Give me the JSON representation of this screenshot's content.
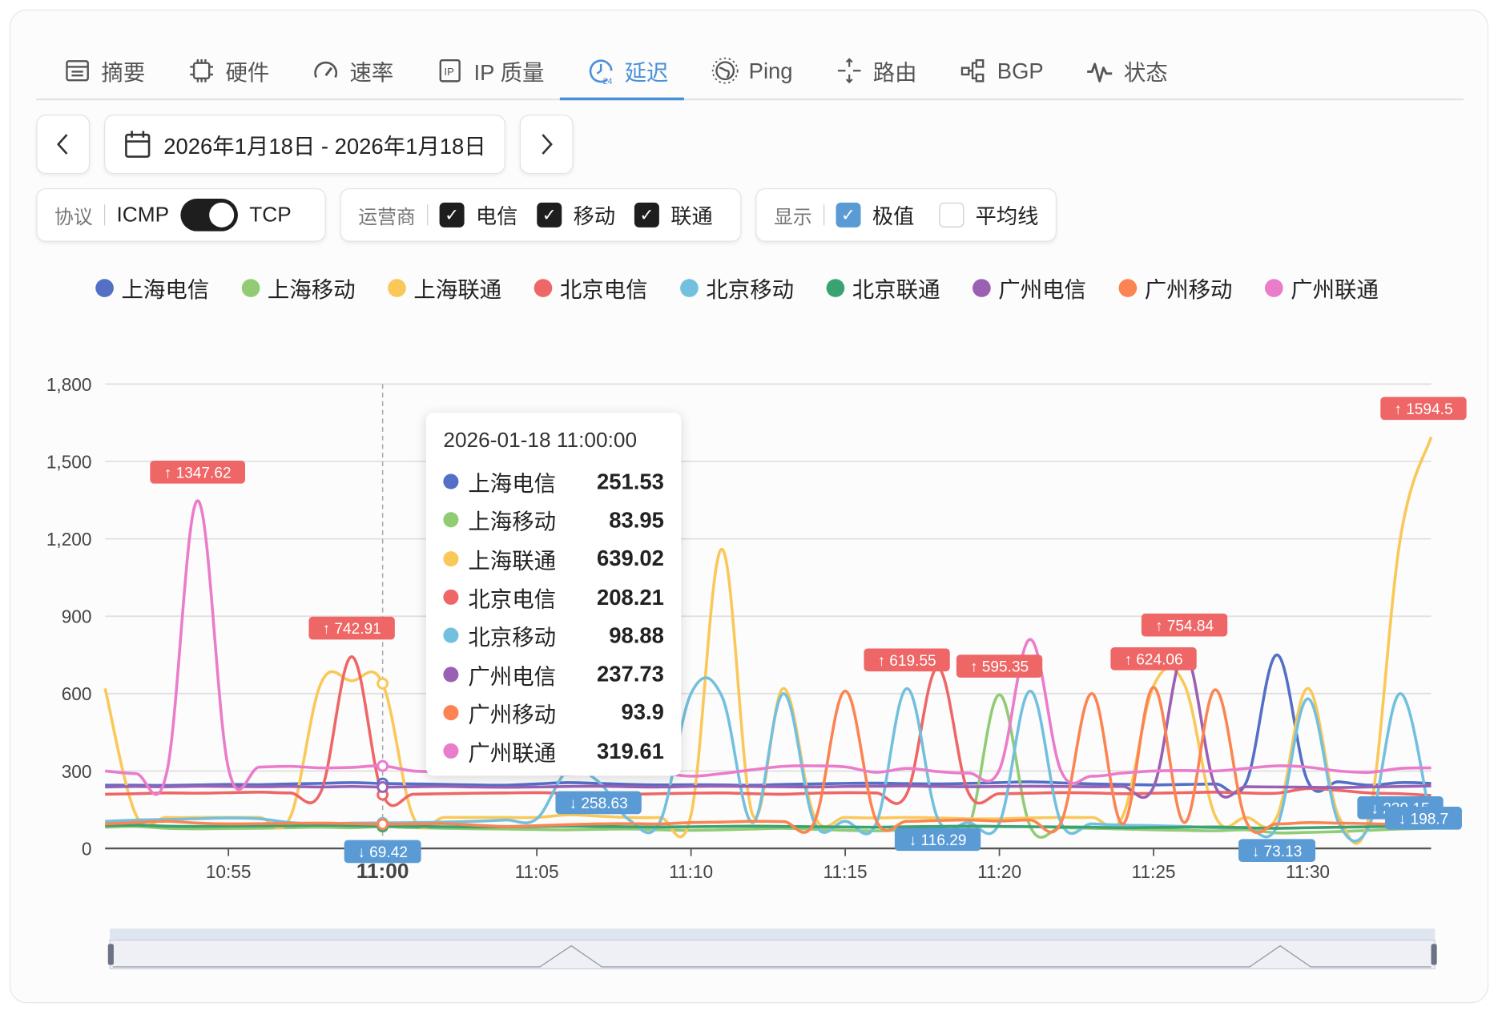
{
  "tabs": [
    {
      "label": "摘要",
      "icon": "summary-icon"
    },
    {
      "label": "硬件",
      "icon": "chip-icon"
    },
    {
      "label": "速率",
      "icon": "speedometer-icon"
    },
    {
      "label": "IP 质量",
      "icon": "ip-icon"
    },
    {
      "label": "延迟",
      "icon": "clock-24-icon",
      "active": true
    },
    {
      "label": "Ping",
      "icon": "globe-icon"
    },
    {
      "label": "路由",
      "icon": "route-icon"
    },
    {
      "label": "BGP",
      "icon": "bgp-icon"
    },
    {
      "label": "状态",
      "icon": "pulse-icon"
    }
  ],
  "date_range": "2026年1月18日 - 2026年1月18日",
  "protocol": {
    "label": "协议",
    "left": "ICMP",
    "right": "TCP",
    "value": "TCP"
  },
  "carrier": {
    "label": "运营商",
    "options": [
      {
        "label": "电信",
        "checked": true
      },
      {
        "label": "移动",
        "checked": true
      },
      {
        "label": "联通",
        "checked": true
      }
    ]
  },
  "display": {
    "label": "显示",
    "options": [
      {
        "label": "极值",
        "checked": true
      },
      {
        "label": "平均线",
        "checked": false
      }
    ]
  },
  "tooltip": {
    "title": "2026-01-18 11:00:00",
    "rows": [
      {
        "name": "上海电信",
        "value": "251.53"
      },
      {
        "name": "上海移动",
        "value": "83.95"
      },
      {
        "name": "上海联通",
        "value": "639.02"
      },
      {
        "name": "北京电信",
        "value": "208.21"
      },
      {
        "name": "北京移动",
        "value": "98.88"
      },
      {
        "name": "广州电信",
        "value": "237.73"
      },
      {
        "name": "广州移动",
        "value": "93.9"
      },
      {
        "name": "广州联通",
        "value": "319.61"
      }
    ]
  },
  "chart_data": {
    "type": "line",
    "x_start": "10:51",
    "x_step_minutes": 1,
    "x_ticks": [
      "10:55",
      "11:00",
      "11:05",
      "11:10",
      "11:15",
      "11:20",
      "11:25",
      "11:30"
    ],
    "y_ticks": [
      "0",
      "300",
      "600",
      "900",
      "1,200",
      "1,500",
      "1,800"
    ],
    "ylim": [
      0,
      1800
    ],
    "grid": true,
    "legend_position": "top",
    "series": [
      {
        "name": "上海电信",
        "color": "#5470c6",
        "values": [
          245,
          245,
          244,
          246,
          248,
          247,
          250,
          252,
          255,
          251.53,
          250,
          248,
          246,
          245,
          250,
          255,
          252,
          248,
          246,
          247,
          246,
          245,
          248,
          250,
          252,
          253,
          251,
          250,
          252,
          255,
          258,
          254,
          250,
          248,
          246,
          248,
          250,
          255,
          750,
          260,
          258,
          245,
          255,
          252
        ]
      },
      {
        "name": "上海移动",
        "color": "#91cc75",
        "values": [
          82,
          85,
          78,
          76,
          77,
          78,
          80,
          82,
          80,
          83.95,
          80,
          78,
          76,
          75,
          73,
          72,
          74,
          75,
          72,
          70,
          72,
          75,
          78,
          74,
          70,
          68,
          72,
          75,
          80,
          595.35,
          85,
          80,
          78,
          75,
          72,
          70,
          68,
          72,
          60,
          62,
          65,
          70,
          75,
          78
        ]
      },
      {
        "name": "上海联通",
        "color": "#fac858",
        "values": [
          620,
          130,
          120,
          120,
          120,
          120,
          120,
          640,
          650,
          639.02,
          120,
          120,
          120,
          120,
          120,
          130,
          125,
          120,
          120,
          130,
          1160,
          130,
          620,
          125,
          120,
          118,
          120,
          118,
          115,
          115,
          118,
          120,
          120,
          125,
          630,
          635,
          125,
          120,
          122,
          620,
          125,
          130,
          1200,
          1594.5
        ]
      },
      {
        "name": "北京电信",
        "color": "#ee6666",
        "values": [
          210,
          212,
          215,
          214,
          216,
          218,
          215,
          220,
          742.91,
          208.21,
          210,
          212,
          214,
          215,
          216,
          214,
          212,
          210,
          212,
          214,
          215,
          212,
          210,
          214,
          216,
          215,
          212,
          700,
          215,
          212,
          214,
          216,
          215,
          212,
          214,
          216,
          218,
          215,
          214,
          232,
          225,
          215,
          212,
          205
        ]
      },
      {
        "name": "北京移动",
        "color": "#73c0de",
        "values": [
          105,
          110,
          112,
          115,
          118,
          115,
          100,
          95,
          98,
          98.88,
          100,
          102,
          105,
          110,
          115,
          300,
          258.63,
          110,
          105,
          600,
          590,
          100,
          600,
          100,
          105,
          95,
          619.55,
          116.29,
          100,
          98,
          610,
          100,
          95,
          90,
          88,
          85,
          80,
          82,
          85,
          580,
          100,
          90,
          600,
          100
        ]
      },
      {
        "name": "北京联通",
        "color": "#3ba272",
        "values": [
          88,
          90,
          86,
          85,
          86,
          87,
          88,
          90,
          88,
          86,
          85,
          84,
          83,
          84,
          85,
          86,
          85,
          84,
          83,
          84,
          85,
          86,
          85,
          84,
          83,
          82,
          84,
          85,
          86,
          85,
          84,
          83,
          82,
          80,
          81,
          82,
          83,
          80,
          78,
          80,
          82,
          84,
          86,
          88
        ]
      },
      {
        "name": "广州电信",
        "color": "#9a60b4",
        "values": [
          238,
          240,
          239,
          241,
          240,
          239,
          240,
          238,
          240,
          237.73,
          239,
          240,
          238,
          237,
          238,
          240,
          241,
          239,
          238,
          240,
          241,
          240,
          239,
          238,
          240,
          241,
          242,
          240,
          239,
          240,
          241,
          240,
          239,
          240,
          238,
          754.84,
          240,
          239,
          238,
          237,
          236,
          238,
          240,
          242
        ]
      },
      {
        "name": "广州移动",
        "color": "#fc8452",
        "values": [
          95,
          100,
          105,
          98,
          95,
          96,
          97,
          98,
          96,
          93.9,
          95,
          96,
          90,
          85,
          88,
          92,
          95,
          96,
          95,
          100,
          102,
          105,
          104,
          102,
          610,
          110,
          105,
          108,
          110,
          106,
          110,
          100,
          600,
          95,
          624.06,
          100,
          615,
          105,
          95,
          100,
          98,
          96,
          92,
          90
        ]
      },
      {
        "name": "广州联通",
        "color": "#ea7ccc",
        "values": [
          300,
          290,
          295,
          1347.62,
          310,
          315,
          318,
          312,
          314,
          319.61,
          300,
          298,
          295,
          290,
          288,
          286,
          290,
          295,
          292,
          280,
          290,
          305,
          318,
          320,
          316,
          295,
          310,
          298,
          292,
          305,
          810,
          300,
          280,
          292,
          300,
          302,
          300,
          310,
          320,
          315,
          300,
          295,
          310,
          312
        ]
      }
    ],
    "max_markers": [
      {
        "label": "↑ 1347.62",
        "index": 3,
        "value": 1347.62
      },
      {
        "label": "↑ 742.91",
        "index": 8,
        "value": 742.91
      },
      {
        "label": "↑ 619.55",
        "index": 26,
        "value": 619.55
      },
      {
        "label": "↑ 595.35",
        "index": 29,
        "value": 595.35
      },
      {
        "label": "↑ 624.06",
        "index": 34,
        "value": 624.06
      },
      {
        "label": "↑ 754.84",
        "index": 35,
        "value": 754.84
      },
      {
        "label": "↑ 1594.5",
        "index": 43,
        "value": 1594.5
      }
    ],
    "min_markers": [
      {
        "label": "↓ 69.42",
        "index": 9,
        "value": 69.42
      },
      {
        "label": "↓ 258.63",
        "index": 16,
        "value": 258.63
      },
      {
        "label": "↓ 116.29",
        "index": 27,
        "value": 116.29
      },
      {
        "label": "↓ 73.13",
        "index": 38,
        "value": 73.13
      },
      {
        "label": "↓ 239.15",
        "index": 42,
        "value": 239.15
      },
      {
        "label": "↓ 198.7",
        "index": 43,
        "value": 198.7
      }
    ],
    "hover_index": 9,
    "colors": {
      "max_label": "#ee6666",
      "min_label": "#5b9bd5"
    }
  }
}
